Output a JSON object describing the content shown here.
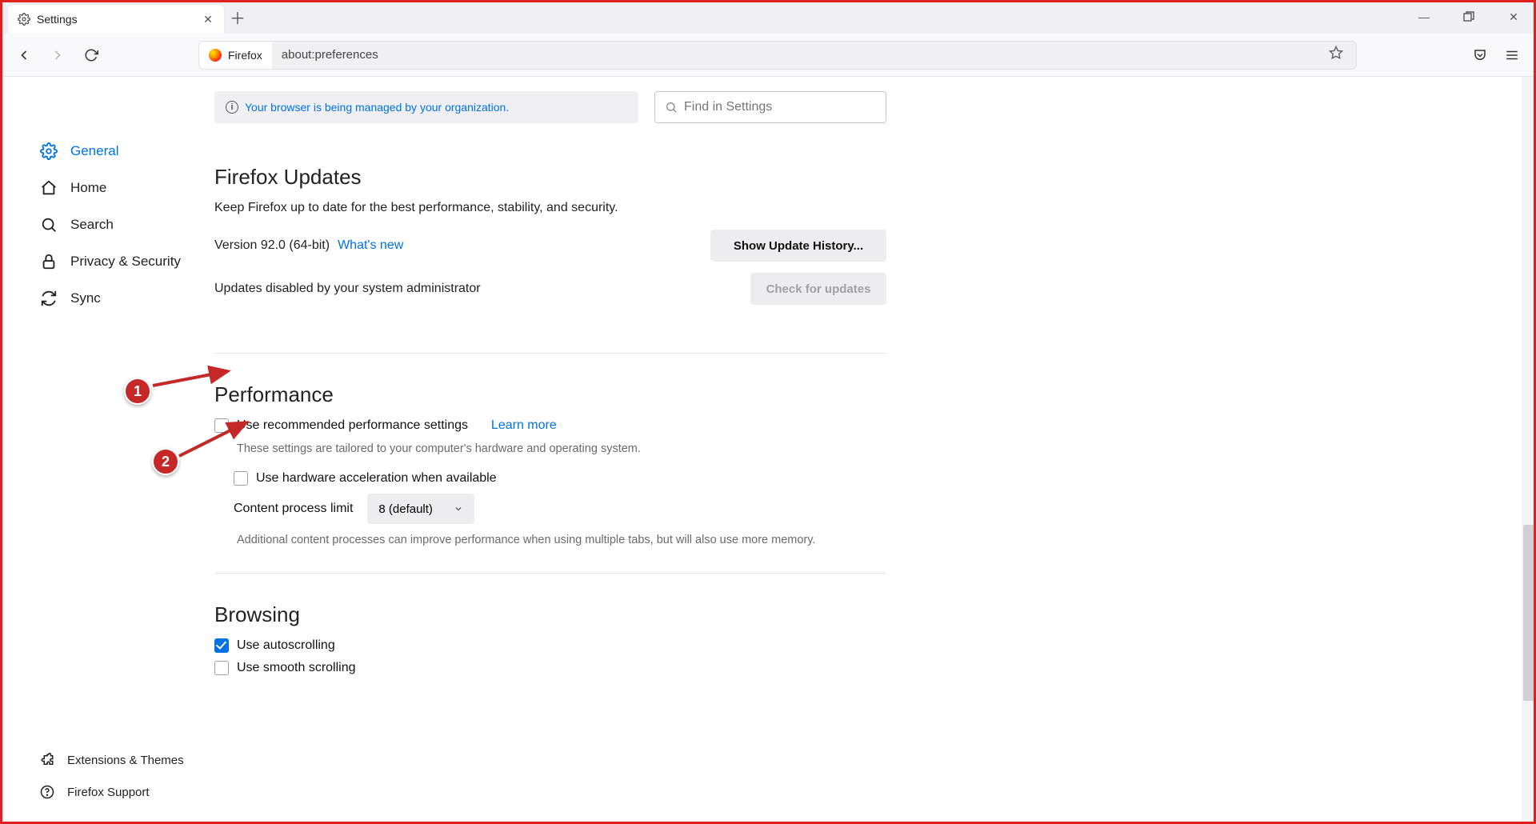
{
  "window": {
    "tab_title": "Settings",
    "url_identity": "Firefox",
    "url": "about:preferences"
  },
  "info_bar": {
    "text": "Your browser is being managed by your organization."
  },
  "search": {
    "placeholder": "Find in Settings"
  },
  "sidebar": {
    "items": [
      {
        "label": "General"
      },
      {
        "label": "Home"
      },
      {
        "label": "Search"
      },
      {
        "label": "Privacy & Security"
      },
      {
        "label": "Sync"
      }
    ],
    "footer": [
      {
        "label": "Extensions & Themes"
      },
      {
        "label": "Firefox Support"
      }
    ]
  },
  "updates": {
    "heading": "Firefox Updates",
    "intro": "Keep Firefox up to date for the best performance, stability, and security.",
    "version": "Version 92.0 (64-bit)",
    "whats_new": "What's new",
    "show_history_btn": "Show Update History...",
    "disabled_text": "Updates disabled by your system administrator",
    "check_btn": "Check for updates"
  },
  "performance": {
    "heading": "Performance",
    "recommended_label": "Use recommended performance settings",
    "learn_more": "Learn more",
    "recommended_help": "These settings are tailored to your computer's hardware and operating system.",
    "hw_accel_label": "Use hardware acceleration when available",
    "process_limit_label": "Content process limit",
    "process_limit_value": "8 (default)",
    "process_help": "Additional content processes can improve performance when using multiple tabs, but will also use more memory."
  },
  "browsing": {
    "heading": "Browsing",
    "autoscroll_label": "Use autoscrolling",
    "smooth_label": "Use smooth scrolling"
  },
  "annotations": {
    "c1": "1",
    "c2": "2"
  }
}
